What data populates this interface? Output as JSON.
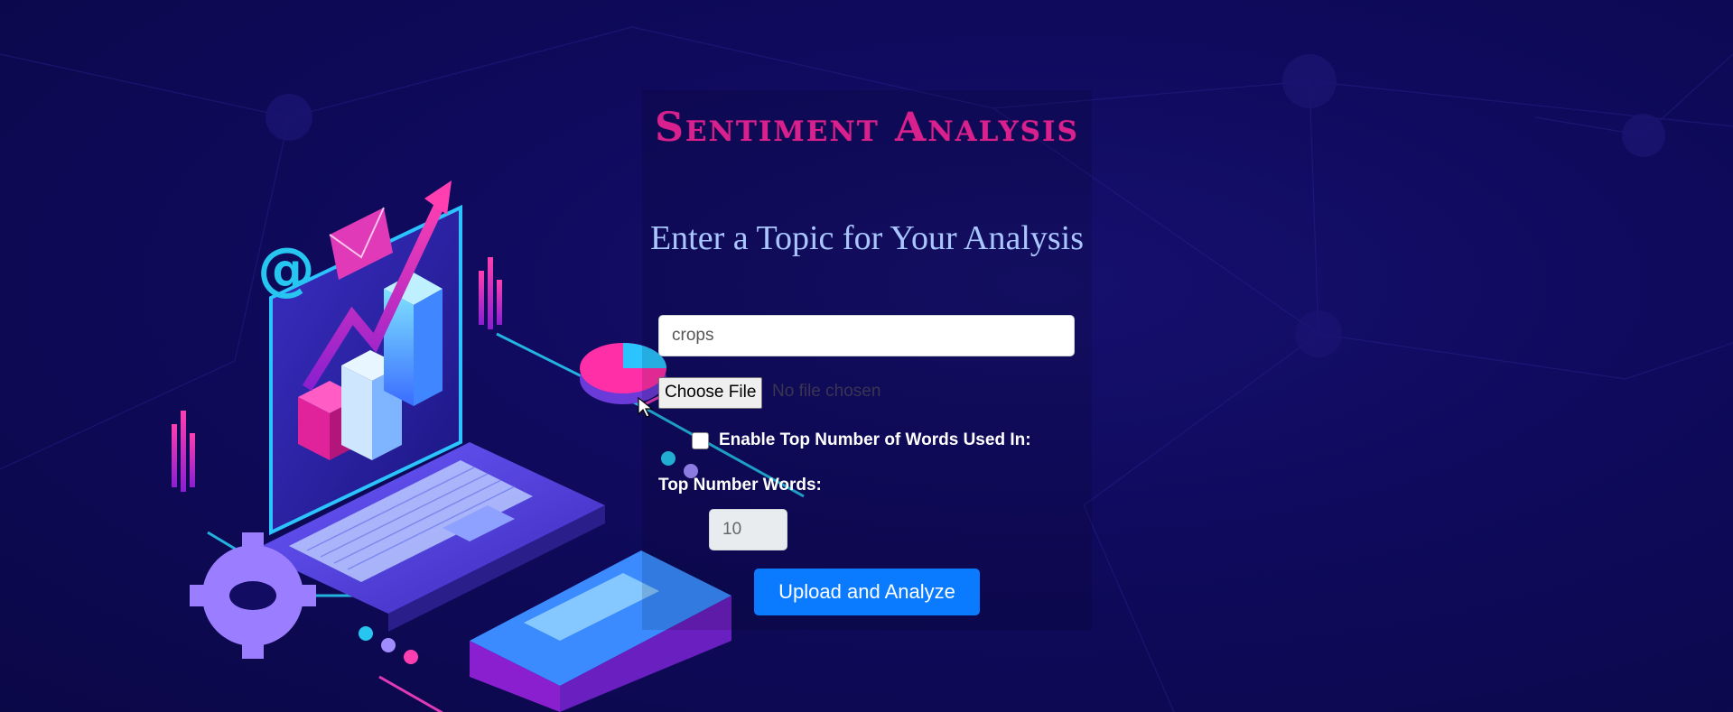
{
  "app": {
    "title": "Sentiment Analysis",
    "subtitle": "Enter a Topic for Your Analysis"
  },
  "form": {
    "topic_value": "crops",
    "file_button_label": "Choose File",
    "file_status": "No file chosen",
    "enable_top_words_label": "Enable Top Number of Words Used In:",
    "enable_top_words_checked": false,
    "top_number_label": "Top Number Words:",
    "top_number_value": "10",
    "submit_label": "Upload and Analyze"
  },
  "illustration": {
    "icons": [
      "at-sign-icon",
      "envelope-icon",
      "gear-icon",
      "laptop-icon",
      "bar-chart-icon",
      "pie-chart-icon",
      "server-icon"
    ]
  },
  "colors": {
    "background": "#0f0a5c",
    "title": "#d8208f",
    "subtitle": "#a9c6ff",
    "button": "#0a7bff"
  }
}
